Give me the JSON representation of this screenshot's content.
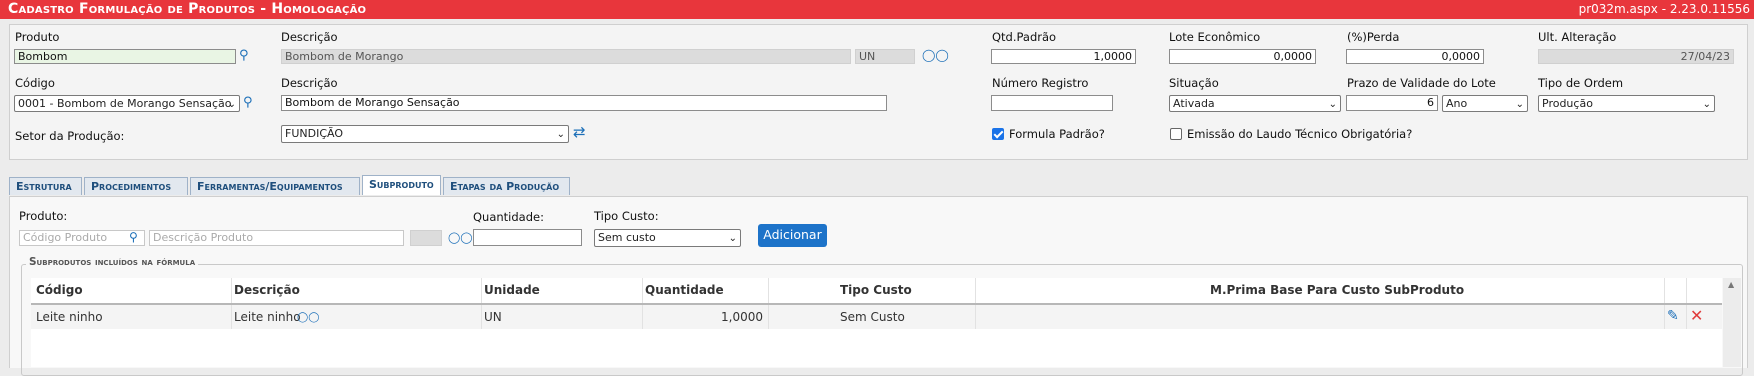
{
  "window": {
    "title": "Cadastro Formulação de Produtos  - Homologação",
    "version": "pr032m.aspx - 2.23.0.11556"
  },
  "form": {
    "produto": {
      "label": "Produto",
      "value": "Bombom"
    },
    "descricao1": {
      "label": "Descrição",
      "value": "Bombom de Morango",
      "unit": "UN"
    },
    "qtd_padrao": {
      "label": "Qtd.Padrão",
      "value": "1,0000"
    },
    "lote_economico": {
      "label": "Lote Econômico",
      "value": "0,0000"
    },
    "perda": {
      "label": "(%)Perda",
      "value": "0,0000"
    },
    "ult_alteracao": {
      "label": "Ult. Alteração",
      "value": "27/04/23"
    },
    "codigo": {
      "label": "Código",
      "value": "0001 - Bombom de Morango Sensação"
    },
    "descricao2": {
      "label": "Descrição",
      "value": "Bombom de Morango Sensação"
    },
    "numero_registro": {
      "label": "Número Registro",
      "value": ""
    },
    "situacao": {
      "label": "Situação",
      "value": "Ativada"
    },
    "prazo_validade": {
      "label": "Prazo de Validade do Lote",
      "value": "6",
      "unit": "Ano"
    },
    "tipo_ordem": {
      "label": "Tipo de Ordem",
      "value": "Produção"
    },
    "setor": {
      "label": "Setor da Produção:",
      "value": "FUNDIÇÃO"
    },
    "formula_padrao": {
      "label": "Formula Padrão?",
      "checked": true
    },
    "emissao_laudo": {
      "label": "Emissão do Laudo Técnico Obrigatória?",
      "checked": false
    }
  },
  "tabs": [
    {
      "label": "Estrutura",
      "active": false
    },
    {
      "label": "Procedimentos",
      "active": false
    },
    {
      "label": "Ferramentas/Equipamentos",
      "active": false
    },
    {
      "label": "Subproduto",
      "active": true
    },
    {
      "label": "Etapas da Produção",
      "active": false
    }
  ],
  "subproduto": {
    "produto_label": "Produto:",
    "codigo_placeholder": "Código Produto",
    "descricao_placeholder": "Descrição Produto",
    "quantidade_label": "Quantidade:",
    "tipo_custo_label": "Tipo Custo:",
    "tipo_custo_value": "Sem custo",
    "add_button": "Adicionar",
    "section_title": "Subprodutos incluídos na fórmula",
    "columns": [
      "Código",
      "Descrição",
      "Unidade",
      "Quantidade",
      "Tipo Custo",
      "M.Prima Base Para Custo SubProduto"
    ],
    "rows": [
      {
        "codigo": "Leite ninho",
        "descricao": "Leite ninho",
        "unidade": "UN",
        "quantidade": "1,0000",
        "tipo_custo": "Sem Custo",
        "mprima": ""
      }
    ]
  },
  "icons": {
    "search": "search-icon",
    "binoculars": "binoculars-icon",
    "refresh": "refresh-icon",
    "edit": "pencil-icon",
    "delete": "close-icon"
  },
  "colors": {
    "titlebar": "#e8363c",
    "accent": "#1d73c9",
    "delete": "#e03b3b"
  }
}
